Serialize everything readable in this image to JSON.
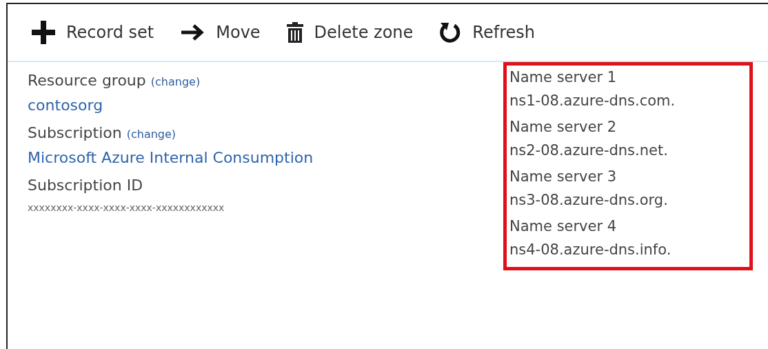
{
  "toolbar": [
    {
      "kind": "add",
      "label": "Record set"
    },
    {
      "kind": "move",
      "label": "Move"
    },
    {
      "kind": "delete",
      "label": "Delete zone"
    },
    {
      "kind": "refresh",
      "label": "Refresh"
    }
  ],
  "properties": [
    {
      "label": "Resource group",
      "action": "(change)",
      "value": "contosorg",
      "kind": "link"
    },
    {
      "label": "Subscription",
      "action": "(change)",
      "value": "Microsoft Azure Internal Consumption",
      "kind": "link"
    },
    {
      "label": "Subscription ID",
      "value": "xxxxxxxx-xxxx-xxxx-xxxx-xxxxxxxxxxxx",
      "kind": "small"
    }
  ],
  "name_servers": [
    {
      "label": "Name server 1",
      "value": "ns1-08.azure-dns.com."
    },
    {
      "label": "Name server 2",
      "value": "ns2-08.azure-dns.net."
    },
    {
      "label": "Name server 3",
      "value": "ns3-08.azure-dns.org."
    },
    {
      "label": "Name server 4",
      "value": "ns4-08.azure-dns.info."
    }
  ]
}
